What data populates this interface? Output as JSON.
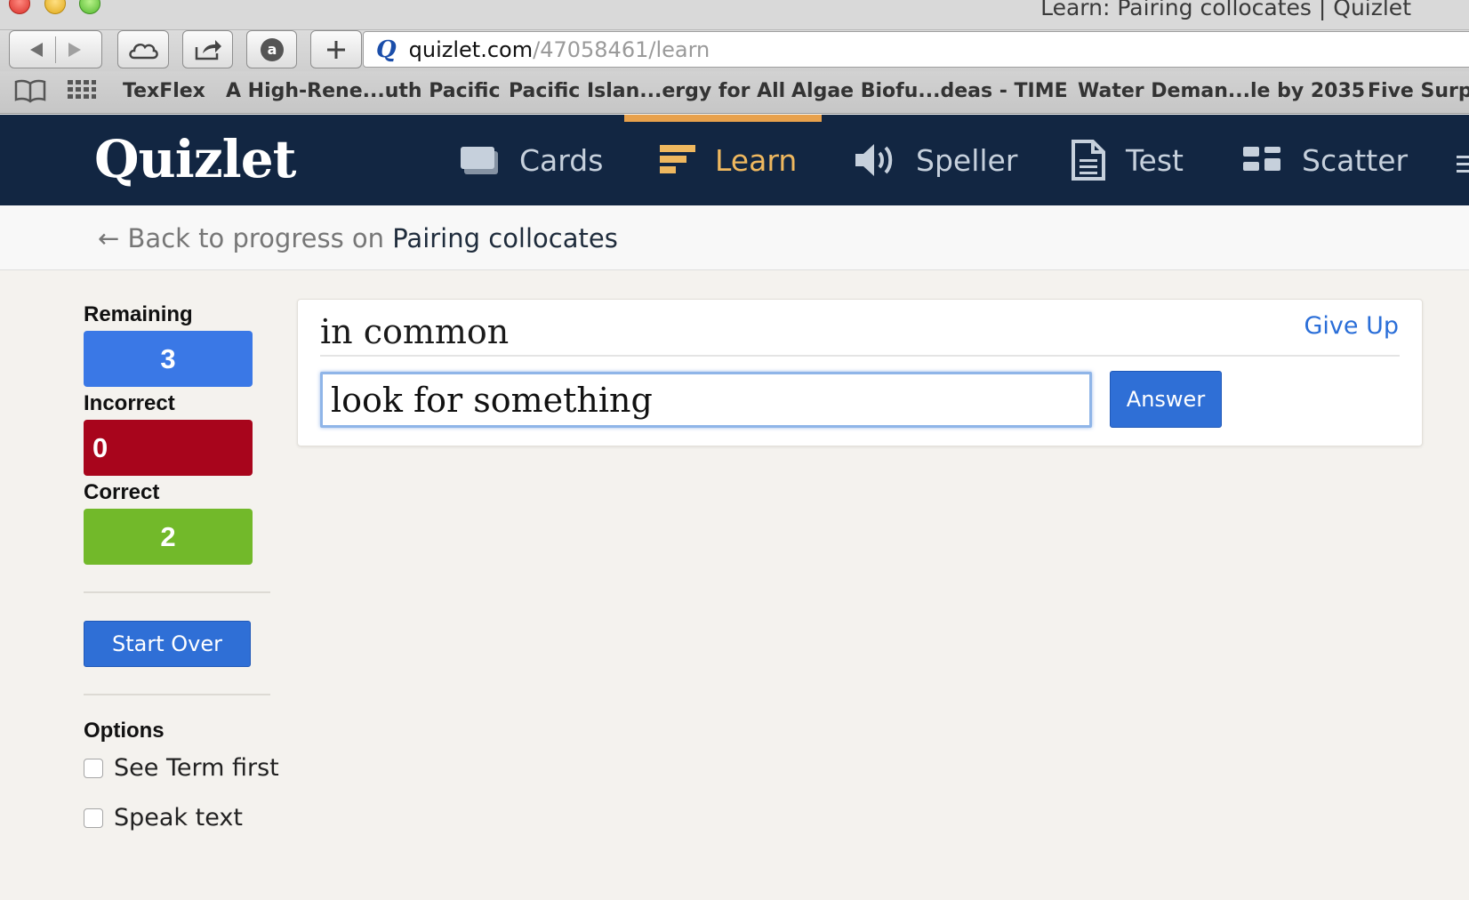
{
  "window": {
    "title": "Learn: Pairing collocates | Quizlet"
  },
  "browser": {
    "url_host": "quizlet.com",
    "url_path": "/47058461/learn",
    "bookmarks": [
      "TexFlex",
      "A High-Rene...uth Pacific",
      "Pacific Islan...ergy for All",
      "Algae Biofu...deas - TIME",
      "Water Deman...le by 2035",
      "Five Surpr"
    ]
  },
  "header": {
    "logo": "Quizlet",
    "modes": [
      {
        "label": "Cards",
        "icon": "cards-icon"
      },
      {
        "label": "Learn",
        "icon": "learn-icon",
        "active": true
      },
      {
        "label": "Speller",
        "icon": "speaker-icon"
      },
      {
        "label": "Test",
        "icon": "document-icon"
      },
      {
        "label": "Scatter",
        "icon": "scatter-icon"
      }
    ],
    "active_color": "#efb85f",
    "bg_color": "#122642"
  },
  "breadcrumb": {
    "arrow": "←",
    "prefix": "Back to progress on",
    "set_name": "Pairing collocates"
  },
  "sidebar": {
    "remaining": {
      "label": "Remaining",
      "value": "3",
      "color": "#3a78e6"
    },
    "incorrect": {
      "label": "Incorrect",
      "value": "0",
      "color": "#a8051c"
    },
    "correct": {
      "label": "Correct",
      "value": "2",
      "color": "#72b92a"
    },
    "start_over": "Start Over",
    "options": {
      "title": "Options",
      "see_term_first": "See Term first",
      "speak_text": "Speak text"
    }
  },
  "card": {
    "prompt": "in common",
    "give_up": "Give Up",
    "answer_value": "look for something",
    "answer_button": "Answer"
  }
}
